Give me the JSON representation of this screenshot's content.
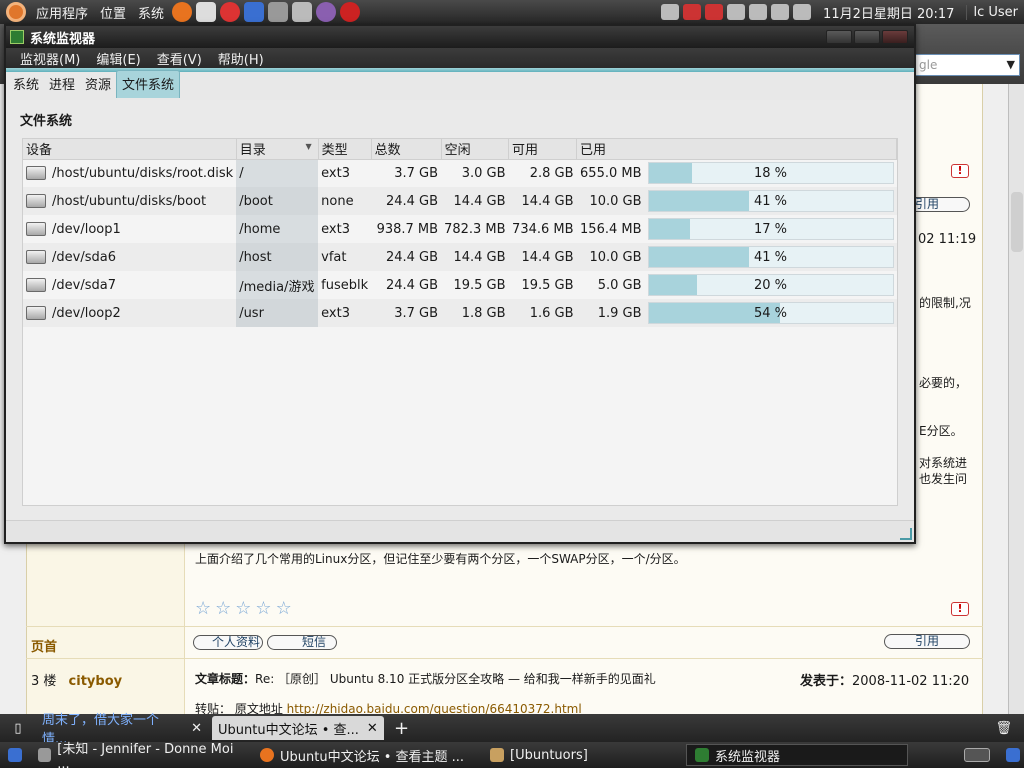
{
  "top_panel": {
    "menus": [
      "应用程序",
      "位置",
      "系统"
    ],
    "clock": "11月2日星期日 20:17",
    "user": "lc User"
  },
  "browser": {
    "search_placeholder": "gle",
    "snippets": [
      "的限制,况",
      "必要的，",
      "E分区。",
      "对系统进",
      "也发生问"
    ],
    "timestamp_right": "02 11:19",
    "partition_note": "上面介绍了几个常用的Linux分区，但记住至少要有两个分区，一个SWAP分区，一个/分区。",
    "floor_label": "页首",
    "buttons": {
      "profile": "个人资料",
      "message": "短信",
      "quote": "引用",
      "alert": "!"
    },
    "post": {
      "floor": "3 楼",
      "author": "cityboy",
      "title_label": "文章标题：",
      "title": "Re: ［原创］ Ubuntu 8.10 正式版分区全攻略 — 给和我一样新手的见面礼",
      "posted_label": "发表于：",
      "posted_time": "2008-11-02 11:20",
      "repost_prefix": "转贴：  原文地址 ",
      "repost_link": "http://zhidao.baidu.com/question/66410372.html"
    }
  },
  "sysmon": {
    "title": "系统监视器",
    "menus": [
      "监视器(M)",
      "编辑(E)",
      "查看(V)",
      "帮助(H)"
    ],
    "tabs": [
      "系统",
      "进程",
      "资源",
      "文件系统"
    ],
    "active_tab": "文件系统",
    "section_title": "文件系统",
    "columns": [
      "设备",
      "目录",
      "类型",
      "总数",
      "空闲",
      "可用",
      "已用"
    ],
    "rows": [
      {
        "device": "/host/ubuntu/disks/root.disk",
        "dir": "/",
        "type": "ext3",
        "total": "3.7 GB",
        "free": "3.0 GB",
        "avail": "2.8 GB",
        "used": "655.0 MB",
        "pct": "18 %",
        "pct_value": 18
      },
      {
        "device": "/host/ubuntu/disks/boot",
        "dir": "/boot",
        "type": "none",
        "total": "24.4 GB",
        "free": "14.4 GB",
        "avail": "14.4 GB",
        "used": "10.0 GB",
        "pct": "41 %",
        "pct_value": 41
      },
      {
        "device": "/dev/loop1",
        "dir": "/home",
        "type": "ext3",
        "total": "938.7 MB",
        "free": "782.3 MB",
        "avail": "734.6 MB",
        "used": "156.4 MB",
        "pct": "17 %",
        "pct_value": 17
      },
      {
        "device": "/dev/sda6",
        "dir": "/host",
        "type": "vfat",
        "total": "24.4 GB",
        "free": "14.4 GB",
        "avail": "14.4 GB",
        "used": "10.0 GB",
        "pct": "41 %",
        "pct_value": 41
      },
      {
        "device": "/dev/sda7",
        "dir": "/media/游戏",
        "type": "fuseblk",
        "total": "24.4 GB",
        "free": "19.5 GB",
        "avail": "19.5 GB",
        "used": "5.0 GB",
        "pct": "20 %",
        "pct_value": 20
      },
      {
        "device": "/dev/loop2",
        "dir": "/usr",
        "type": "ext3",
        "total": "3.7 GB",
        "free": "1.8 GB",
        "avail": "1.6 GB",
        "used": "1.9 GB",
        "pct": "54 %",
        "pct_value": 54
      }
    ]
  },
  "tab_bar": {
    "tabs": [
      "周末了，借大家一个情...",
      "Ubuntu中文论坛 • 查..."
    ],
    "add": "+"
  },
  "taskbar": {
    "tasks": [
      "[未知 - Jennifer - Donne Moi ...",
      "Ubuntu中文论坛 • 查看主题 ...",
      "[Ubuntuors]",
      "系统监视器"
    ]
  }
}
